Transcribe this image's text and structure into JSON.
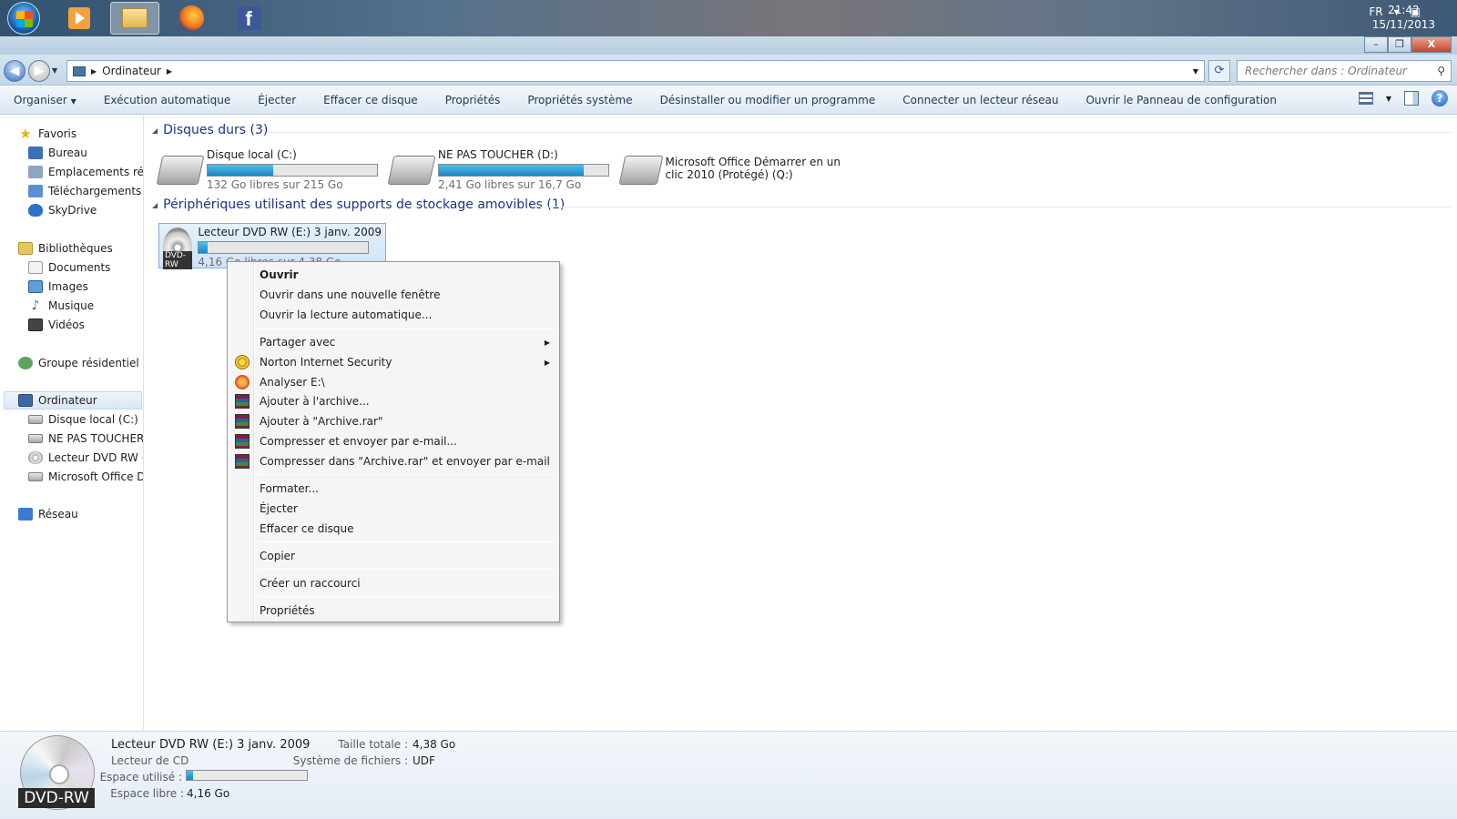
{
  "taskbar": {
    "apps": [
      {
        "name": "start-orb"
      },
      {
        "name": "media-player-icon"
      },
      {
        "name": "explorer-icon"
      },
      {
        "name": "firefox-icon"
      },
      {
        "name": "facebook-icon",
        "glyph": "f"
      }
    ],
    "language": "FR",
    "time": "21:42",
    "date": "15/11/2013"
  },
  "window": {
    "buttons": {
      "minimize": "–",
      "restore": "❐",
      "close": "X"
    }
  },
  "address": {
    "breadcrumb": "Ordinateur",
    "search_placeholder": "Rechercher dans : Ordinateur"
  },
  "toolbar": {
    "items": [
      "Organiser",
      "Exécution automatique",
      "Éjecter",
      "Effacer ce disque",
      "Propriétés",
      "Propriétés système",
      "Désinstaller ou modifier un programme",
      "Connecter un lecteur réseau",
      "Ouvrir le Panneau de configuration"
    ]
  },
  "nav": {
    "favoris": "Favoris",
    "bureau": "Bureau",
    "emplacements": "Emplacements récents",
    "telechargements": "Téléchargements",
    "skydrive": "SkyDrive",
    "bibliotheques": "Bibliothèques",
    "documents": "Documents",
    "images": "Images",
    "musique": "Musique",
    "videos": "Vidéos",
    "groupe": "Groupe résidentiel",
    "ordinateur": "Ordinateur",
    "disque_c": "Disque local (C:)",
    "ne_pas_toucher": "NE PAS TOUCHER (D:)",
    "lecteur_dvd": "Lecteur DVD RW (E:)",
    "ms_office": "Microsoft Office Démarrer",
    "reseau": "Réseau"
  },
  "content": {
    "group_hdd": "Disques durs (3)",
    "group_removable": "Périphériques utilisant des supports de stockage amovibles (1)",
    "drives": [
      {
        "name": "Disque local (C:)",
        "free": "132 Go libres sur 215 Go",
        "used_fraction": 0.386
      },
      {
        "name": "NE PAS TOUCHER (D:)",
        "free": "2,41 Go libres sur 16,7 Go",
        "used_fraction": 0.856
      },
      {
        "name_line1": "Microsoft Office Démarrer en un",
        "name_line2": "clic 2010 (Protégé) (Q:)"
      }
    ],
    "dvd": {
      "name": "Lecteur DVD RW (E:) 3 janv. 2009",
      "free": "4,16 Go libres sur 4,38 Go",
      "used_fraction": 0.05,
      "badge": "DVD-RW"
    }
  },
  "context_menu": {
    "ouvrir": "Ouvrir",
    "ouvrir_nouvelle": "Ouvrir dans une nouvelle fenêtre",
    "lecture_auto": "Ouvrir la lecture automatique...",
    "partager": "Partager avec",
    "norton": "Norton Internet Security",
    "analyser": "Analyser E:\\",
    "ajouter_archive": "Ajouter à l'archive...",
    "ajouter_rar": "Ajouter à \"Archive.rar\"",
    "compresser_email": "Compresser et envoyer par e-mail...",
    "compresser_rar_email": "Compresser dans \"Archive.rar\" et envoyer par e-mail",
    "formater": "Formater...",
    "ejecter": "Éjecter",
    "effacer": "Effacer ce disque",
    "copier": "Copier",
    "raccourci": "Créer un raccourci",
    "proprietes": "Propriétés"
  },
  "details": {
    "title": "Lecteur DVD RW (E:) 3 janv. 2009",
    "subtitle": "Lecteur de CD",
    "espace_utilise_label": "Espace utilisé :",
    "espace_libre_label": "Espace libre :",
    "espace_libre_value": "4,16 Go",
    "taille_totale_label": "Taille totale :",
    "taille_totale_value": "4,38 Go",
    "systeme_fichiers_label": "Système de fichiers :",
    "systeme_fichiers_value": "UDF",
    "used_fraction": 0.05,
    "badge": "DVD-RW"
  }
}
